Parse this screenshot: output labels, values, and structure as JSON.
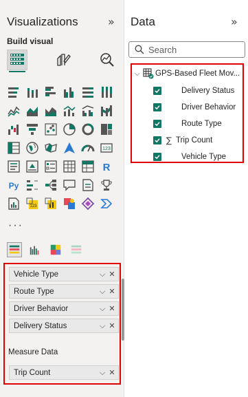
{
  "visualizations": {
    "title": "Visualizations",
    "build_visual": "Build visual",
    "more": "···",
    "wells": {
      "fields": [
        "Vehicle Type",
        "Route Type",
        "Driver Behavior",
        "Delivery Status"
      ],
      "measure_label": "Measure Data",
      "measure_fields": [
        "Trip Count"
      ]
    }
  },
  "data": {
    "title": "Data",
    "search_placeholder": "Search",
    "table": {
      "name": "GPS-Based Fleet Mov...",
      "fields": [
        {
          "label": "Delivery Status",
          "checked": true,
          "sigma": false
        },
        {
          "label": "Driver Behavior",
          "checked": true,
          "sigma": false
        },
        {
          "label": "Route Type",
          "checked": true,
          "sigma": false
        },
        {
          "label": "Trip Count",
          "checked": true,
          "sigma": true
        },
        {
          "label": "Vehicle Type",
          "checked": true,
          "sigma": false
        }
      ]
    }
  },
  "colors": {
    "accent": "#117865",
    "highlight_border": "#e00000"
  }
}
